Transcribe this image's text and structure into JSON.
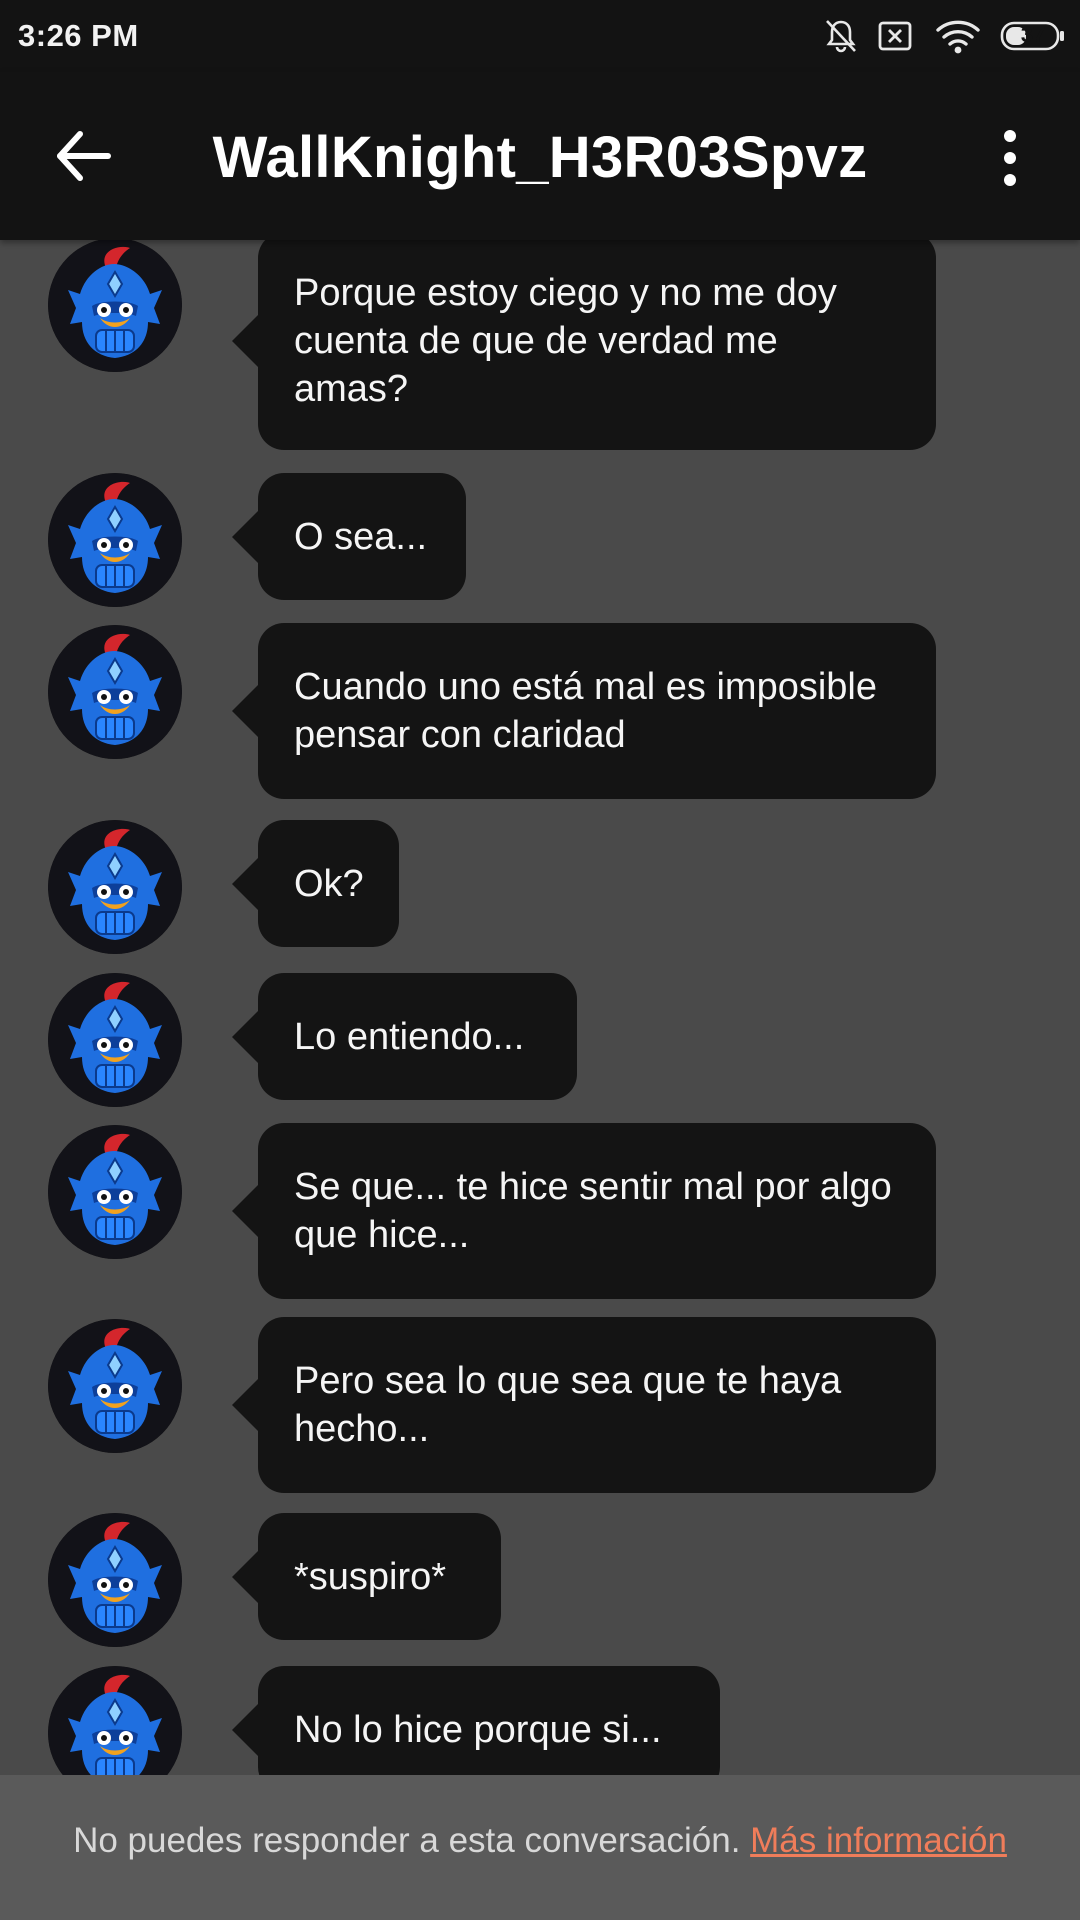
{
  "status_bar": {
    "time": "3:26 PM",
    "battery": "37",
    "icons": [
      "bell-off-icon",
      "sim-x-icon",
      "wifi-icon",
      "battery-icon"
    ]
  },
  "app_bar": {
    "title": "WallKnight_H3R03Spvz",
    "back_icon": "arrow-left-icon",
    "more_icon": "more-vert-icon"
  },
  "messages": [
    {
      "text": "Porque estoy ciego y no me doy cuenta de que de verdad me amas?"
    },
    {
      "text": "O sea..."
    },
    {
      "text": "Cuando uno está mal es imposible pensar con claridad"
    },
    {
      "text": "Ok?"
    },
    {
      "text": "Lo entiendo..."
    },
    {
      "text": "Se que... te hice sentir mal por algo que hice..."
    },
    {
      "text": "Pero sea lo que sea que te haya hecho..."
    },
    {
      "text": "*suspiro*"
    },
    {
      "text": "No lo hice porque si..."
    }
  ],
  "footer": {
    "notice": "No puedes responder a esta conversación.",
    "link": "Más información",
    "link_color": "#f07d5a"
  }
}
